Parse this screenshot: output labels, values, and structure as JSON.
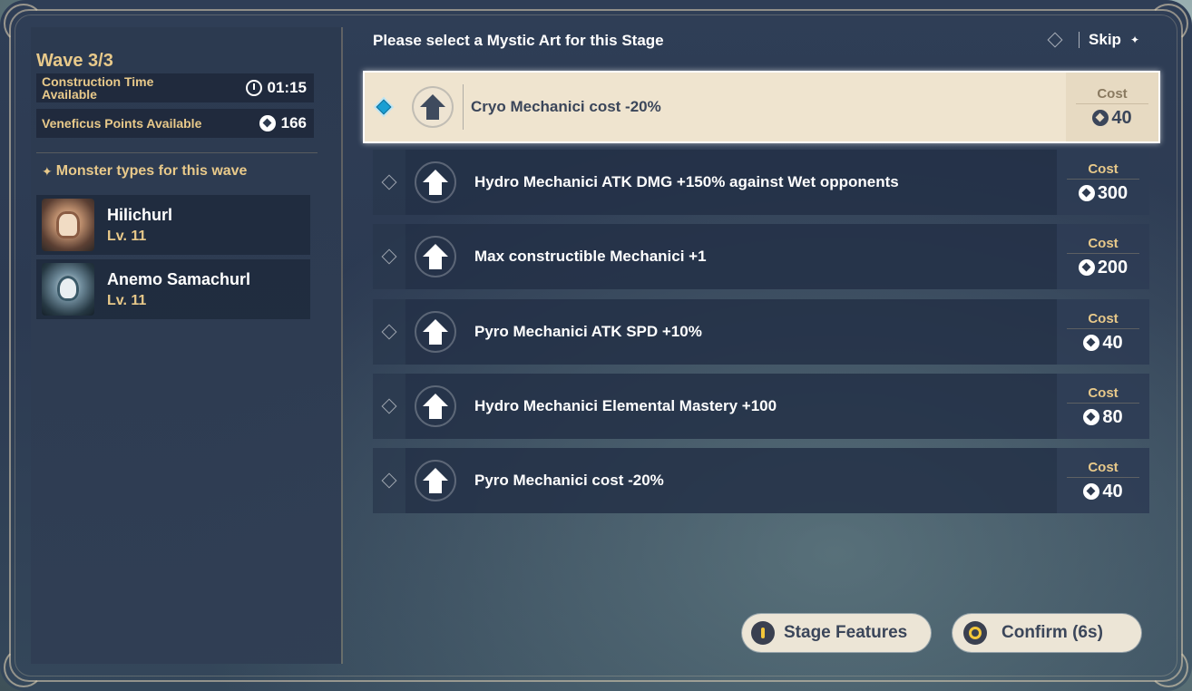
{
  "left_panel": {
    "wave_title": "Wave 3/3",
    "construction_time_label": "Construction Time Available",
    "construction_time_value": "01:15",
    "veneficus_label": "Veneficus Points Available",
    "veneficus_value": "166",
    "monster_header": "Monster types for this wave",
    "monsters": [
      {
        "name": "Hilichurl",
        "level": "Lv. 11"
      },
      {
        "name": "Anemo Samachurl",
        "level": "Lv. 11"
      }
    ]
  },
  "header": {
    "prompt": "Please select a Mystic Art for this Stage",
    "skip_label": "Skip"
  },
  "options": [
    {
      "label": "Cryo Mechanici cost -20%",
      "cost_label": "Cost",
      "cost": "40",
      "selected": true
    },
    {
      "label": "Hydro Mechanici ATK DMG +150% against Wet opponents",
      "cost_label": "Cost",
      "cost": "300",
      "selected": false
    },
    {
      "label": "Max constructible Mechanici +1",
      "cost_label": "Cost",
      "cost": "200",
      "selected": false
    },
    {
      "label": "Pyro Mechanici ATK SPD +10%",
      "cost_label": "Cost",
      "cost": "40",
      "selected": false
    },
    {
      "label": "Hydro Mechanici Elemental Mastery +100",
      "cost_label": "Cost",
      "cost": "80",
      "selected": false
    },
    {
      "label": "Pyro Mechanici cost -20%",
      "cost_label": "Cost",
      "cost": "40",
      "selected": false
    }
  ],
  "buttons": {
    "stage_features": "Stage Features",
    "confirm": "Confirm (6s)"
  },
  "colors": {
    "gold": "#e8c98a",
    "selected_bg": "#efe4cf",
    "selected_marker": "#1b9fd3",
    "button_bg": "#ece5d6",
    "accent_yellow": "#f3c63a"
  }
}
